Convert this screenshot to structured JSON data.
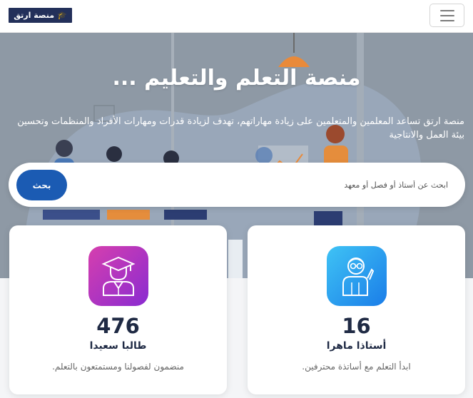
{
  "nav": {
    "logo_text": "منصة ارتق",
    "menu_icon": "hamburger-menu-icon"
  },
  "hero": {
    "title": "منصة التعلم والتعليم ...",
    "description": "منصة ارتق تساعد المعلمين والمتعلمين على زيادة مهاراتهم، تهدف لزيادة قدرات ومهارات الأفراد والمنظمات وتحسين بيئة العمل والانتاجية"
  },
  "search": {
    "placeholder": "ابحث عن أستاذ أو فصل أو معهد",
    "button_label": "بحث",
    "value": ""
  },
  "stats": {
    "teachers": {
      "number": "16",
      "title": "أستاذا ماهرا",
      "description": "ابدأ التعلم مع أساتذة محترفين.",
      "icon": "teacher-icon"
    },
    "students": {
      "number": "476",
      "title": "طالبا سعيدا",
      "description": "منضمون لفصولنا ومستمتعون بالتعلم.",
      "icon": "graduate-student-icon"
    }
  },
  "colors": {
    "brand_dark": "#23305a",
    "primary_button": "#1b5bb3",
    "teacher_gradient": [
      "#3fc3f5",
      "#1a7de8"
    ],
    "student_gradient": [
      "#d63fae",
      "#8a2bd1"
    ]
  }
}
